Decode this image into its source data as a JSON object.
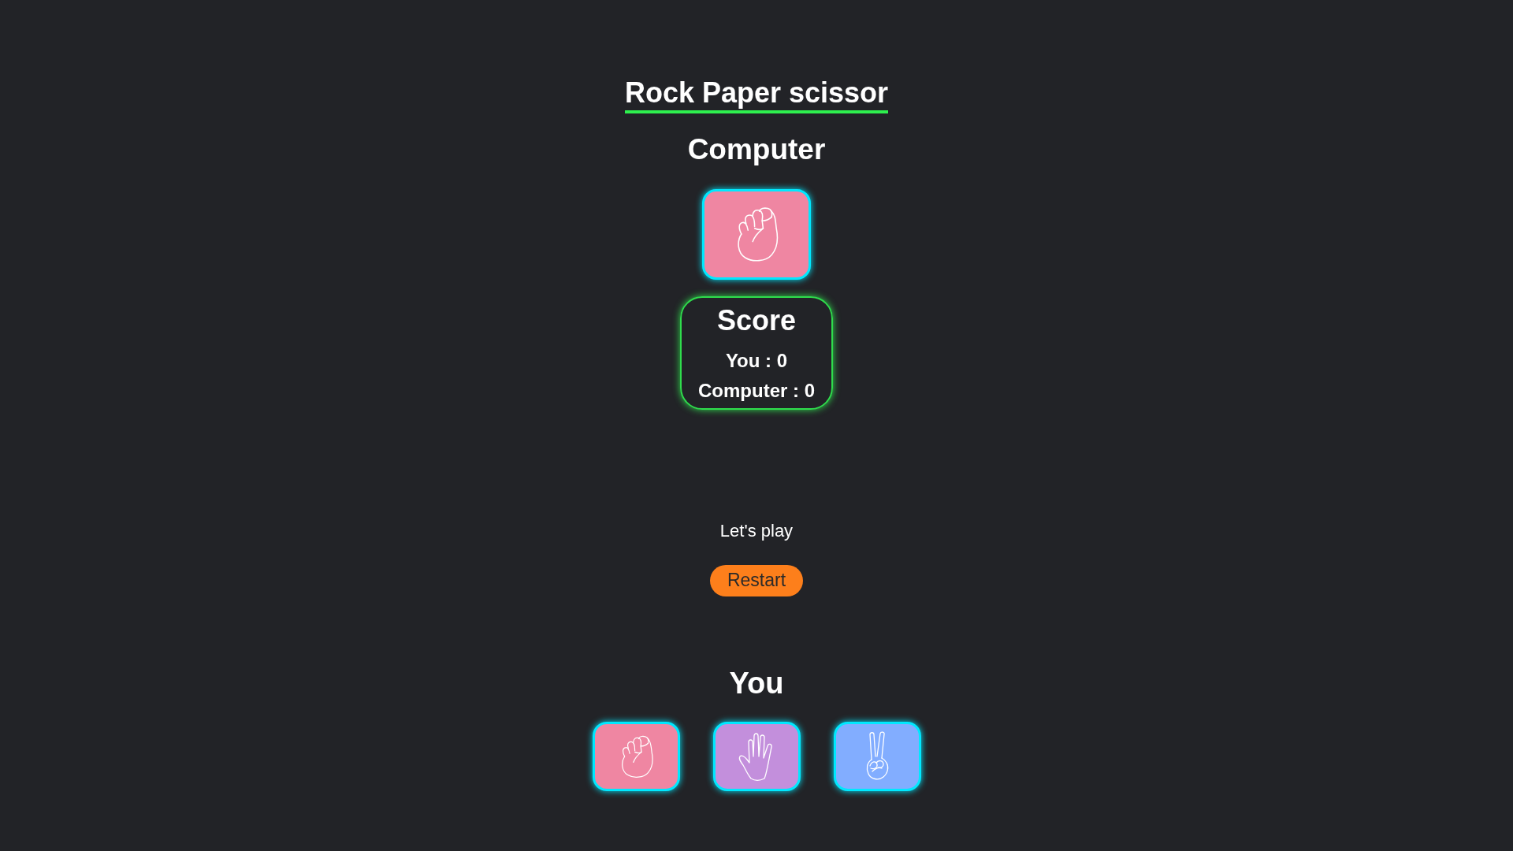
{
  "title": "Rock Paper scissor",
  "computer": {
    "heading": "Computer",
    "choice": {
      "kind": "rock"
    }
  },
  "score": {
    "heading": "Score",
    "lines": [
      "You : 0",
      "Computer : 0"
    ]
  },
  "message": "Let's play",
  "restart_button": "Restart",
  "player": {
    "heading": "You",
    "choices": [
      {
        "kind": "rock",
        "color": "#ef86a2"
      },
      {
        "kind": "paper",
        "color": "#c38fdc"
      },
      {
        "kind": "scissors",
        "color": "#82adff"
      }
    ]
  }
}
